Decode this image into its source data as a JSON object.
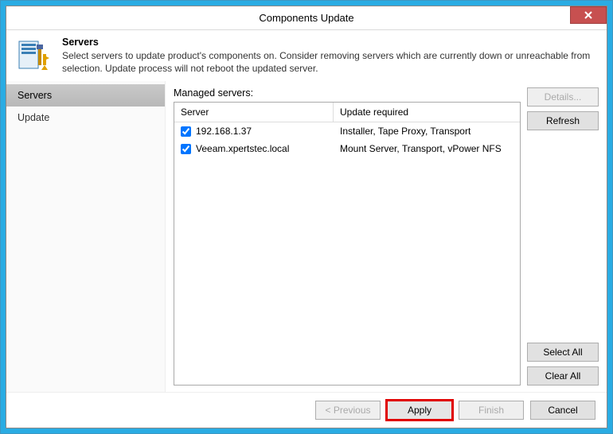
{
  "window": {
    "title": "Components Update"
  },
  "header": {
    "title": "Servers",
    "description": "Select servers to update product's components on. Consider removing servers which are currently down or unreachable from selection. Update process will not reboot the updated server."
  },
  "sidebar": {
    "items": [
      {
        "label": "Servers",
        "active": true
      },
      {
        "label": "Update",
        "active": false
      }
    ]
  },
  "main": {
    "list_label": "Managed servers:",
    "columns": {
      "server": "Server",
      "update": "Update required"
    },
    "rows": [
      {
        "server": "192.168.1.37",
        "update": "Installer, Tape Proxy, Transport",
        "checked": true
      },
      {
        "server": "Veeam.xpertstec.local",
        "update": "Mount Server, Transport, vPower NFS",
        "checked": true
      }
    ]
  },
  "side_buttons": {
    "details": "Details...",
    "refresh": "Refresh",
    "select_all": "Select All",
    "clear_all": "Clear All"
  },
  "footer": {
    "previous": "< Previous",
    "apply": "Apply",
    "finish": "Finish",
    "cancel": "Cancel"
  }
}
